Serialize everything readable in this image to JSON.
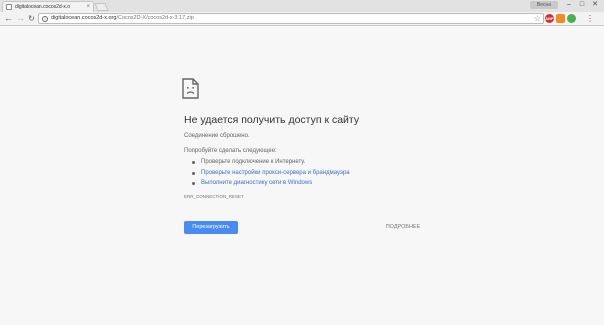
{
  "window": {
    "user_chip": "Весна",
    "minimize_glyph": "–",
    "maximize_glyph": "□",
    "close_glyph": "✕"
  },
  "tab": {
    "title": "digitalocean.cocos2d-x.o",
    "close_glyph": "×"
  },
  "toolbar": {
    "back_glyph": "←",
    "forward_glyph": "→",
    "reload_glyph": "↻",
    "info_glyph": "i",
    "url_host": "digitalocean.cocos2d-x.org",
    "url_path": "/Cocos2D-X/cocos2d-x-3.17.zip",
    "star_glyph": "☆",
    "abp_label": "ABP",
    "menu_glyph": "⋮"
  },
  "icons": {
    "error_icon": "sad-document-icon",
    "info_icon": "info-circle-icon",
    "star_icon": "bookmark-star-icon"
  },
  "error_page": {
    "heading": "Не удается получить доступ к сайту",
    "description": "Соединение сброшено.",
    "try_label": "Попробуйте сделать следующее:",
    "suggestions": [
      {
        "text": "Проверьте подключение к Интернету.",
        "is_link": false
      },
      {
        "text": "Проверьте настройки прокси-сервера и брандмауэра",
        "is_link": true
      },
      {
        "text": "Выполните диагностику сети в Windows",
        "is_link": true
      }
    ],
    "error_code": "ERR_CONNECTION_RESET",
    "reload_label": "Перезагрузить",
    "details_label": "ПОДРОБНЕЕ"
  },
  "colors": {
    "page_bg": "#f7f7f7",
    "link": "#3c6ec8",
    "button_blue": "#4a8af4",
    "text_primary": "#333333",
    "text_secondary": "#646464"
  }
}
